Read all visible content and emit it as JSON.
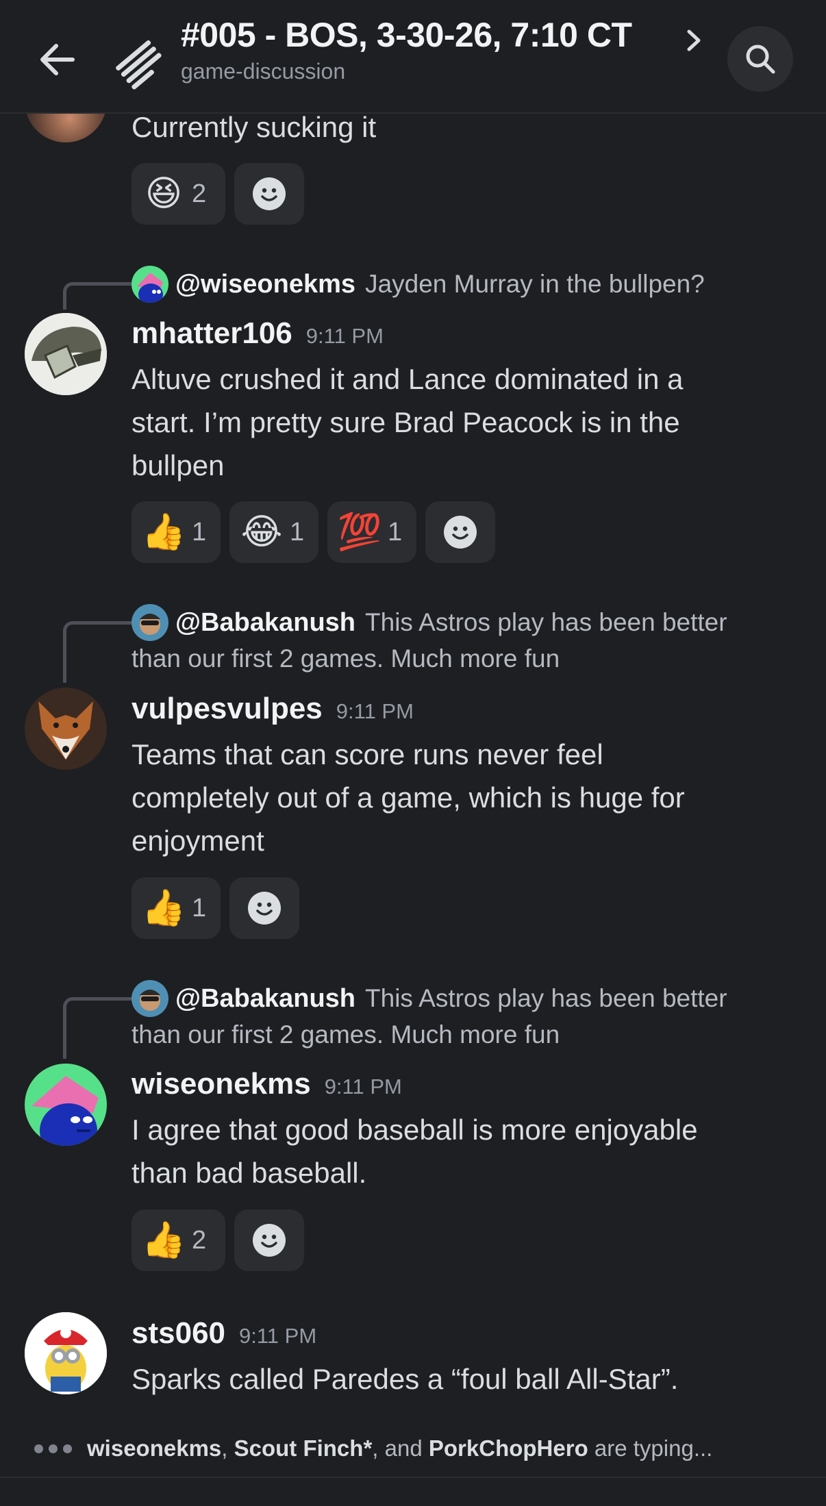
{
  "header": {
    "title": "#005 - BOS, 3-30-26, 7:10 CT",
    "subtitle": "game-discussion"
  },
  "messages": [
    {
      "text": "Currently sucking it",
      "reactions": [
        {
          "emoji": "😆",
          "count": "2"
        }
      ]
    },
    {
      "reply_to": {
        "name": "@wiseonekms",
        "text": "Jayden Murray in the bullpen?"
      },
      "username": "mhatter106",
      "time": "9:11 PM",
      "lines": [
        "Altuve crushed it and Lance dominated in a",
        "start.  I’m pretty sure Brad Peacock is in the",
        "bullpen"
      ],
      "reactions": [
        {
          "emoji": "👍",
          "count": "1"
        },
        {
          "emoji": "😂",
          "count": "1"
        },
        {
          "emoji": "💯",
          "count": "1"
        }
      ]
    },
    {
      "reply_to": {
        "name": "@Babakanush",
        "text": "This Astros play has been better",
        "text2": "than our first 2 games.  Much more fun"
      },
      "username": "vulpesvulpes",
      "time": "9:11 PM",
      "lines": [
        "Teams that can score runs never feel",
        "completely out of a game, which is huge for",
        "enjoyment"
      ],
      "reactions": [
        {
          "emoji": "👍",
          "count": "1"
        }
      ]
    },
    {
      "reply_to": {
        "name": "@Babakanush",
        "text": "This Astros play has been better",
        "text2": "than our first 2 games.  Much more fun"
      },
      "username": "wiseonekms",
      "time": "9:11 PM",
      "lines": [
        "I agree that good baseball is more enjoyable",
        "than bad baseball."
      ],
      "reactions": [
        {
          "emoji": "👍",
          "count": "2"
        }
      ]
    },
    {
      "username": "sts060",
      "time": "9:11 PM",
      "lines": [
        "Sparks called Paredes a “foul ball All-Star”."
      ]
    }
  ],
  "typing": {
    "user1": "wiseonekms",
    "sep1": ", ",
    "user2": "Scout Finch*",
    "sep2": ", and ",
    "user3": "PorkChopHero",
    "suffix": " are typing..."
  },
  "icons": {
    "back": "arrow-left-icon",
    "thread": "thread-icon",
    "search": "search-icon",
    "add_reaction": "smiley-add-reaction-icon"
  },
  "colors": {
    "background": "#1e1f22",
    "reaction_bg": "#2b2d31",
    "text": "#dbdee1",
    "muted": "#949ba4"
  }
}
